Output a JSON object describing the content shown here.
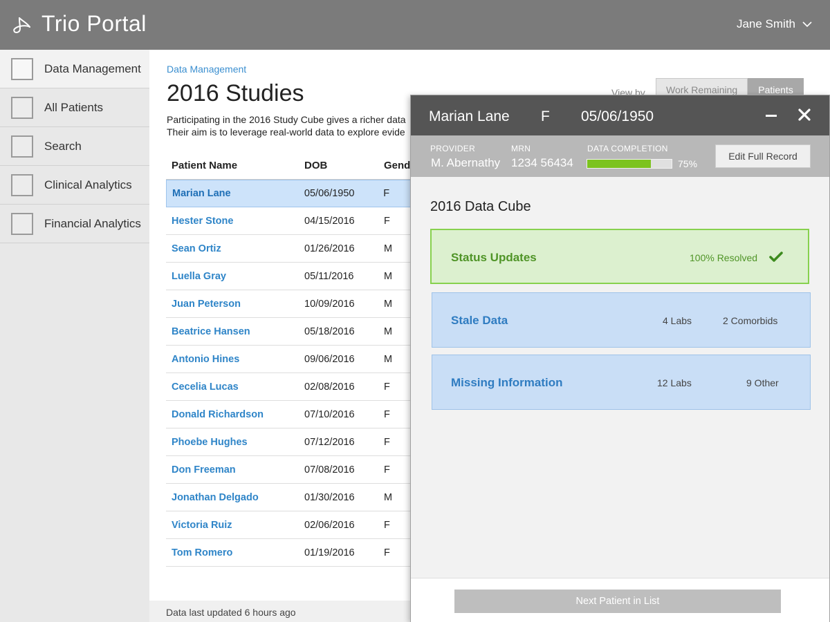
{
  "header": {
    "app_title": "Trio Portal",
    "user_name": "Jane Smith",
    "user_menu_icon": "chevron-down-icon",
    "logo_icon": "trio-logo-icon"
  },
  "sidebar": {
    "items": [
      {
        "label": "Data Management",
        "active": true
      },
      {
        "label": "All Patients",
        "active": false
      },
      {
        "label": "Search",
        "active": false
      },
      {
        "label": "Clinical Analytics",
        "active": false
      },
      {
        "label": "Financial Analytics",
        "active": false
      }
    ]
  },
  "main": {
    "breadcrumb": "Data Management",
    "title": "2016 Studies",
    "description_line1": "Participating in the 2016 Study Cube gives a richer data",
    "description_line2": "Their aim is to leverage real-world data to explore evide",
    "view_by_label": "View by",
    "view_toggle": [
      "Work Remaining",
      "Patients"
    ],
    "view_selected": "Patients",
    "table": {
      "headers": [
        "Patient Name",
        "DOB",
        "Gender"
      ],
      "rows": [
        {
          "name": "Marian Lane",
          "dob": "05/06/1950",
          "gender": "F",
          "selected": true
        },
        {
          "name": "Hester Stone",
          "dob": "04/15/2016",
          "gender": "F"
        },
        {
          "name": "Sean Ortiz",
          "dob": "01/26/2016",
          "gender": "M"
        },
        {
          "name": "Luella Gray",
          "dob": "05/11/2016",
          "gender": "M"
        },
        {
          "name": "Juan Peterson",
          "dob": "10/09/2016",
          "gender": "M"
        },
        {
          "name": "Beatrice Hansen",
          "dob": "05/18/2016",
          "gender": "M"
        },
        {
          "name": "Antonio Hines",
          "dob": "09/06/2016",
          "gender": "M"
        },
        {
          "name": "Cecelia Lucas",
          "dob": "02/08/2016",
          "gender": "F"
        },
        {
          "name": "Donald Richardson",
          "dob": "07/10/2016",
          "gender": "F"
        },
        {
          "name": "Phoebe Hughes",
          "dob": "07/12/2016",
          "gender": "F"
        },
        {
          "name": "Don Freeman",
          "dob": "07/08/2016",
          "gender": "F"
        },
        {
          "name": "Jonathan Delgado",
          "dob": "01/30/2016",
          "gender": "M"
        },
        {
          "name": "Victoria Ruiz",
          "dob": "02/06/2016",
          "gender": "F"
        },
        {
          "name": "Tom Romero",
          "dob": "01/19/2016",
          "gender": "F"
        }
      ]
    },
    "footer_text": "Data last updated 6 hours ago"
  },
  "panel": {
    "patient_name": "Marian Lane",
    "gender": "F",
    "dob": "05/06/1950",
    "provider_label": "PROVIDER",
    "provider_value": "M. Abernathy",
    "mrn_label": "MRN",
    "mrn_value": "1234 56434",
    "completion_label": "DATA COMPLETION",
    "completion_value": "75%",
    "completion_fraction": 0.75,
    "edit_button": "Edit Full Record",
    "cube_title": "2016 Data Cube",
    "cards": {
      "status": {
        "title": "Status Updates",
        "stat": "100% Resolved",
        "icon": "check-icon"
      },
      "stale": {
        "title": "Stale Data",
        "stat1": "4 Labs",
        "stat2": "2 Comorbids"
      },
      "missing": {
        "title": "Missing Information",
        "stat1": "12 Labs",
        "stat2": "9 Other"
      }
    },
    "next_button": "Next Patient in List"
  },
  "colors": {
    "topbar": "#7b7b7b",
    "accent_blue": "#2f85c8",
    "resolved_green": "#87d14e",
    "progress_green": "#7cc31f"
  }
}
